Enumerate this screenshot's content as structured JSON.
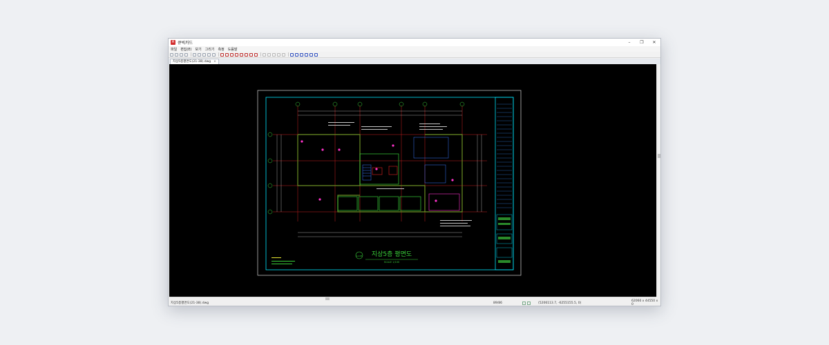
{
  "window": {
    "title": "큐빅카드",
    "app_icon": "A",
    "controls": {
      "minimize": "–",
      "maximize": "❐",
      "close": "✕"
    }
  },
  "menu": [
    {
      "label": "파일"
    },
    {
      "label": "편집(E)"
    },
    {
      "label": "보기"
    },
    {
      "label": "그리기"
    },
    {
      "label": "측정"
    },
    {
      "label": "도움말"
    }
  ],
  "toolbar": {
    "icons": [
      "new-icon",
      "open-icon",
      "save-icon",
      "print-icon",
      "cut-icon",
      "copy-icon",
      "paste-icon",
      "undo-icon",
      "redo-icon",
      "select-icon",
      "line-icon",
      "polyline-icon",
      "arc-icon",
      "circle-icon",
      "rectangle-icon",
      "polygon-icon",
      "text-icon",
      "zoom-in-icon",
      "zoom-out-icon",
      "zoom-extent-icon",
      "pan-icon",
      "measure-icon",
      "layer-icon",
      "color-icon",
      "hatch-icon",
      "grid-icon",
      "snap-icon",
      "settings-icon"
    ]
  },
  "document": {
    "tab_label": "지상5층평면도(21-38).dwg",
    "tab_close": "×"
  },
  "drawing": {
    "title_main": "지상5층 평면도",
    "title_sub": "SCALE 1/100",
    "title_marker": "A-105"
  },
  "status": {
    "file": "지상5층평면도(21-38).dwg",
    "page": "89/86",
    "coordinates": "(5206113.7, -6255155.5, 0)",
    "size": "62060 x 44550 x 0"
  },
  "colors": {
    "canvas_bg": "#000000",
    "frame_cyan": "#00e5ff",
    "grid_red": "#cc1f1f",
    "wall_green": "#3ad13a",
    "accent_magenta": "#ff33cc",
    "accent_blue": "#3b7bff",
    "text_yellow": "#e8e832"
  }
}
